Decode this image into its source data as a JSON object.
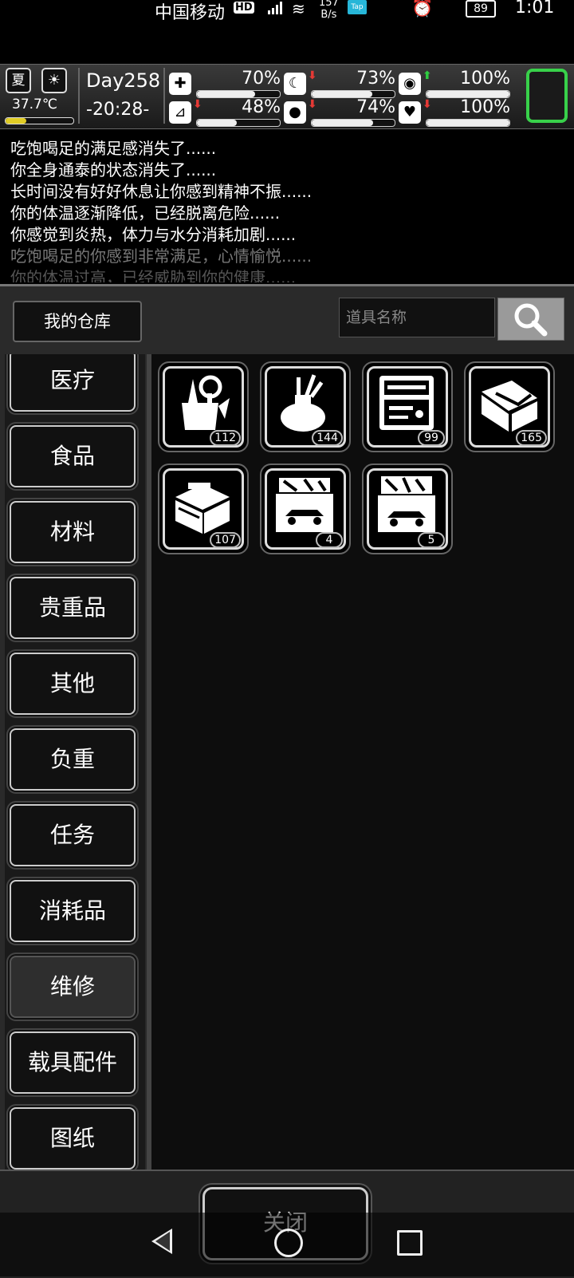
{
  "statusbar": {
    "carrier": "中国移动",
    "hd": "HD",
    "speed_top": "157",
    "speed_bottom": "B/s",
    "tap": "Tap",
    "battery": "89",
    "time": "1:01"
  },
  "hud": {
    "season": "夏",
    "temperature": "37.7℃",
    "temperature_level": 0.3,
    "day": "Day258",
    "clock": "-20:28-",
    "stats": [
      {
        "icon": "medkit-icon",
        "glyph": "✚",
        "arrow": "",
        "pct": "70%",
        "level": 0.7
      },
      {
        "icon": "stomach-icon",
        "glyph": "☾",
        "arrow": "⬇",
        "arrow_color": "#e53935",
        "pct": "73%",
        "level": 0.73
      },
      {
        "icon": "brain-icon",
        "glyph": "◉",
        "arrow": "⬆",
        "arrow_color": "#2ecc40",
        "pct": "100%",
        "level": 1.0
      },
      {
        "icon": "foot-icon",
        "glyph": "⊿",
        "arrow": "⬇",
        "arrow_color": "#e53935",
        "pct": "48%",
        "level": 0.48
      },
      {
        "icon": "water-icon",
        "glyph": "●",
        "arrow": "⬇",
        "arrow_color": "#e53935",
        "pct": "74%",
        "level": 0.74
      },
      {
        "icon": "heart-icon",
        "glyph": "♥",
        "arrow": "⬇",
        "arrow_color": "#e53935",
        "pct": "100%",
        "level": 1.0
      }
    ]
  },
  "log": [
    {
      "text": "吃饱喝足的满足感消失了......",
      "color": "#ffffff"
    },
    {
      "text": "你全身通泰的状态消失了......",
      "color": "#ffffff"
    },
    {
      "text": "长时间没有好好休息让你感到精神不振......",
      "color": "#ffffff"
    },
    {
      "text": "你的体温逐渐降低，已经脱离危险......",
      "color": "#ffffff"
    },
    {
      "text": "你感觉到炎热，体力与水分消耗加剧......",
      "color": "#ffffff"
    },
    {
      "text": "吃饱喝足的你感到非常满足，心情愉悦......",
      "color": "#777777"
    },
    {
      "text": "你的体温过高，已经威胁到你的健康......",
      "color": "#555555"
    }
  ],
  "warehouse": {
    "title": "我的仓库",
    "search_placeholder": "道具名称"
  },
  "categories": [
    "医疗",
    "食品",
    "材料",
    "贵重品",
    "其他",
    "负重",
    "任务",
    "消耗品",
    "维修",
    "载具配件",
    "图纸"
  ],
  "active_category": "维修",
  "items": [
    {
      "name": "toolbag-item",
      "count": "112"
    },
    {
      "name": "tool-sack-item",
      "count": "144"
    },
    {
      "name": "toolkit-case-item",
      "count": "99"
    },
    {
      "name": "pliers-box-item",
      "count": "165"
    },
    {
      "name": "toolbox-item",
      "count": "107"
    },
    {
      "name": "car-repair-kit-item",
      "count": "4"
    },
    {
      "name": "car-repair-kit-large-item",
      "count": "5"
    }
  ],
  "close_label": "关闭"
}
